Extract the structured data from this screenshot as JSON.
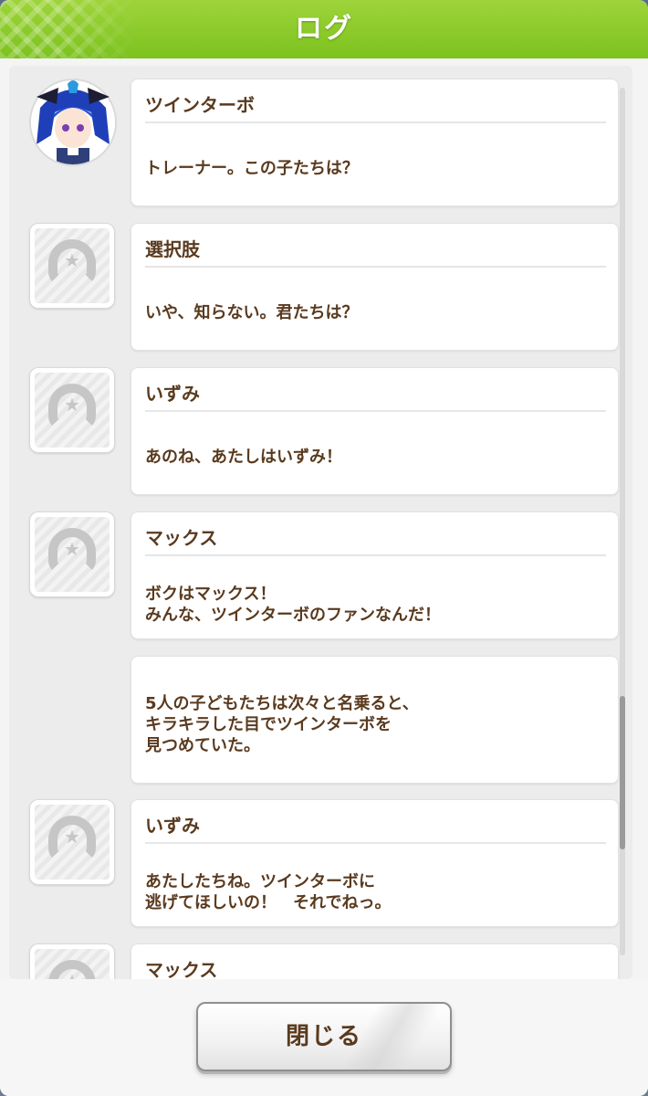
{
  "header": {
    "title": "ログ"
  },
  "entries": [
    {
      "speaker": "ツインターボ",
      "text": "トレーナー。この子たちは？"
    },
    {
      "speaker": "選択肢",
      "text": "いや、知らない。君たちは？"
    },
    {
      "speaker": "いずみ",
      "text": "あのね、あたしはいずみ！"
    },
    {
      "speaker": "マックス",
      "text": "ボクはマックス！\nみんな、ツインターボのファンなんだ！"
    },
    {
      "speaker": "",
      "text": "5人の子どもたちは次々と名乗ると、\nキラキラした目でツインターボを\n見つめていた。"
    },
    {
      "speaker": "いずみ",
      "text": "あたしたちね。ツインターボに\n逃げてほしいの！　それでねっ。"
    },
    {
      "speaker": "マックス",
      "text": ""
    }
  ],
  "footer": {
    "close_label": "閉じる"
  },
  "colors": {
    "header_green": "#8ccb2a",
    "text_brown": "#5a3a1e"
  }
}
